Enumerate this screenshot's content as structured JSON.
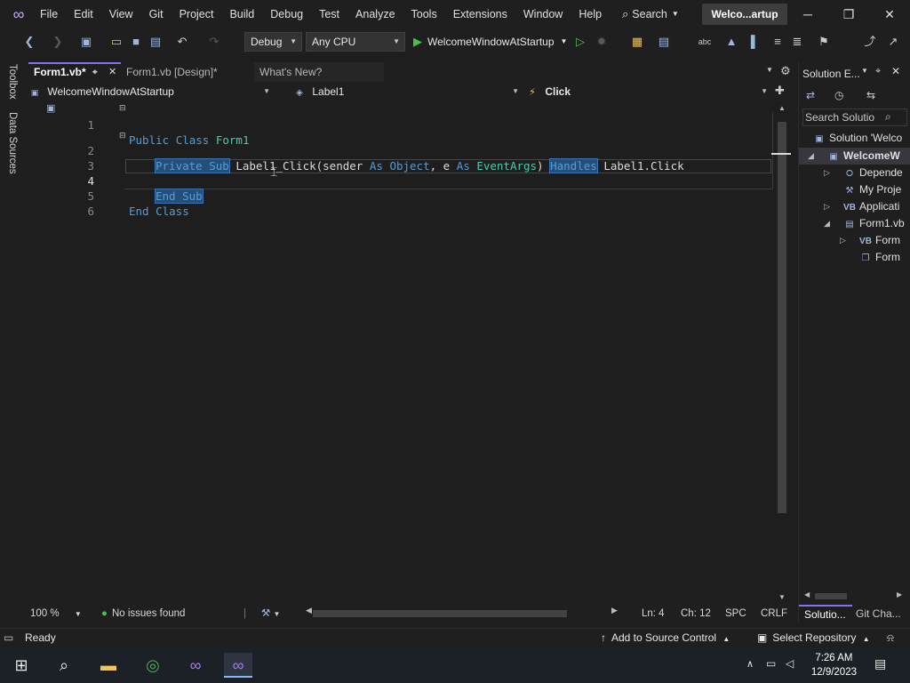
{
  "menubar": {
    "items": [
      "File",
      "Edit",
      "View",
      "Git",
      "Project",
      "Build",
      "Debug",
      "Test",
      "Analyze",
      "Tools",
      "Extensions",
      "Window",
      "Help"
    ],
    "search_label": "Search",
    "window_title": "Welco...artup"
  },
  "toolbar": {
    "config": "Debug",
    "platform": "Any CPU",
    "startup_project": "WelcomeWindowAtStartup"
  },
  "left_rail": {
    "toolbox": "Toolbox",
    "data_sources": "Data Sources"
  },
  "doc_tabs": [
    {
      "label": "Form1.vb*",
      "active": true
    },
    {
      "label": "Form1.vb [Design]*",
      "active": false
    },
    {
      "label": "What's New?",
      "active": false
    }
  ],
  "navbar": {
    "project": "WelcomeWindowAtStartup",
    "object": "Label1",
    "event": "Click"
  },
  "editor": {
    "line_numbers": [
      "1",
      "2",
      "3",
      "4",
      "5",
      "6"
    ],
    "line1": {
      "kw1": "Public",
      "kw2": "Class",
      "name": "Form1"
    },
    "line2": {
      "kw_private_sub": "Private Sub",
      "method": "Label1_Click(sender",
      "as1": "As",
      "type1": "Object",
      "comma_e": ", e",
      "as2": "As",
      "type2": "EventArgs",
      "paren": ")",
      "handles": "Handles",
      "target": "Label1.Click"
    },
    "line4": {
      "end_sub": "End Sub"
    },
    "line5": {
      "end_class_kw": "End",
      "end_class_kw2": "Class"
    }
  },
  "edit_status": {
    "zoom": "100 %",
    "issues": "No issues found",
    "line": "Ln: 4",
    "col": "Ch: 12",
    "whitespace": "SPC",
    "line_endings": "CRLF"
  },
  "solution_explorer": {
    "title": "Solution E...",
    "search_placeholder": "Search Solutio",
    "items": [
      {
        "label": "Solution 'Welco",
        "icon": "solution-icon"
      },
      {
        "label": "WelcomeW",
        "icon": "vb-project-icon"
      },
      {
        "label": "Depende",
        "icon": "dependencies-icon"
      },
      {
        "label": "My Proje",
        "icon": "wrench-icon"
      },
      {
        "label": "Applicati",
        "icon": "vb-file-icon"
      },
      {
        "label": "Form1.vb",
        "icon": "form-icon"
      },
      {
        "label": "Form",
        "icon": "vb-file-icon"
      },
      {
        "label": "Form",
        "icon": "resx-icon"
      }
    ],
    "bottom_tabs": [
      "Solutio...",
      "Git Cha..."
    ]
  },
  "statusbar": {
    "ready": "Ready",
    "source_control": "Add to Source Control",
    "repository": "Select Repository"
  },
  "taskbar": {
    "time": "7:26 AM",
    "date": "12/9/2023"
  },
  "colors": {
    "accent": "#8a6ff0",
    "selection": "#264f78",
    "keyword": "#569cd6",
    "type": "#4ec9b0"
  }
}
